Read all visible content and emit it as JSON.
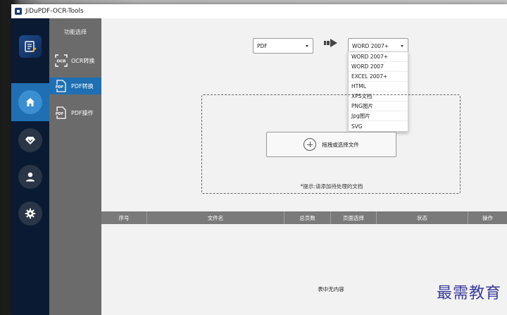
{
  "window": {
    "title": "JiDuPDF-OCR-Tools"
  },
  "sidebar": {
    "items": [
      {
        "icon": "home-icon",
        "active": true
      },
      {
        "icon": "diamond-icon",
        "active": false
      },
      {
        "icon": "user-icon",
        "active": false
      },
      {
        "icon": "gear-icon",
        "active": false
      }
    ]
  },
  "function_panel": {
    "title": "功能选择",
    "items": [
      {
        "label": "OCR转换",
        "icon": "ocr-scan-icon",
        "active": false
      },
      {
        "label": "PDF转换",
        "icon": "pdf-document-icon",
        "active": true
      },
      {
        "label": "PDF操作",
        "icon": "pdf-document-icon",
        "active": false
      }
    ]
  },
  "conversion": {
    "source_format": "PDF",
    "target_format": "WORD 2007+",
    "target_options": [
      "WORD 2007+",
      "WORD 2007",
      "EXCEL 2007+",
      "HTML",
      "XPS文档",
      "PNG图片",
      "Jpg图片",
      "SVG"
    ]
  },
  "dropzone": {
    "button_label": "拖拽或选择文件",
    "hint": "*提示:请添加待处理的文档"
  },
  "table": {
    "columns": [
      "序号",
      "文件名",
      "总页数",
      "页面选择",
      "状态",
      "操作"
    ],
    "rows": [],
    "empty_text": "表中无内容"
  },
  "watermark": "最需教育",
  "colors": {
    "sidebar_bg": "#0b1a33",
    "accent": "#1f6fb2",
    "panel_bg": "#6b6b6b",
    "table_header_bg": "#7a7a7a"
  }
}
